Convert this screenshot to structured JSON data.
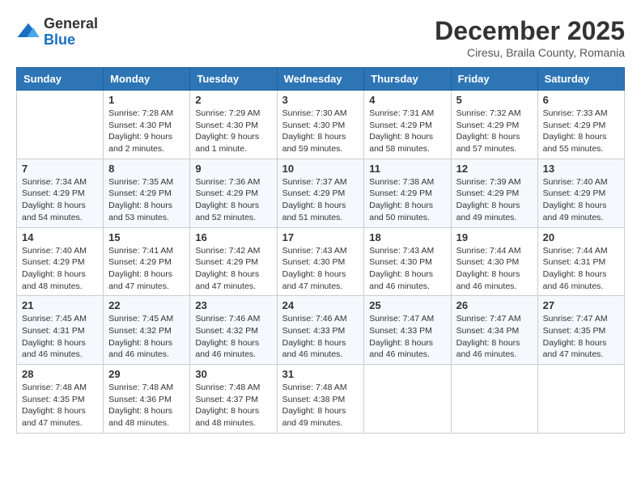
{
  "header": {
    "logo_general": "General",
    "logo_blue": "Blue",
    "month_title": "December 2025",
    "subtitle": "Ciresu, Braila County, Romania"
  },
  "days_of_week": [
    "Sunday",
    "Monday",
    "Tuesday",
    "Wednesday",
    "Thursday",
    "Friday",
    "Saturday"
  ],
  "weeks": [
    [
      {
        "day": "",
        "info": ""
      },
      {
        "day": "1",
        "info": "Sunrise: 7:28 AM\nSunset: 4:30 PM\nDaylight: 9 hours\nand 2 minutes."
      },
      {
        "day": "2",
        "info": "Sunrise: 7:29 AM\nSunset: 4:30 PM\nDaylight: 9 hours\nand 1 minute."
      },
      {
        "day": "3",
        "info": "Sunrise: 7:30 AM\nSunset: 4:30 PM\nDaylight: 8 hours\nand 59 minutes."
      },
      {
        "day": "4",
        "info": "Sunrise: 7:31 AM\nSunset: 4:29 PM\nDaylight: 8 hours\nand 58 minutes."
      },
      {
        "day": "5",
        "info": "Sunrise: 7:32 AM\nSunset: 4:29 PM\nDaylight: 8 hours\nand 57 minutes."
      },
      {
        "day": "6",
        "info": "Sunrise: 7:33 AM\nSunset: 4:29 PM\nDaylight: 8 hours\nand 55 minutes."
      }
    ],
    [
      {
        "day": "7",
        "info": "Sunrise: 7:34 AM\nSunset: 4:29 PM\nDaylight: 8 hours\nand 54 minutes."
      },
      {
        "day": "8",
        "info": "Sunrise: 7:35 AM\nSunset: 4:29 PM\nDaylight: 8 hours\nand 53 minutes."
      },
      {
        "day": "9",
        "info": "Sunrise: 7:36 AM\nSunset: 4:29 PM\nDaylight: 8 hours\nand 52 minutes."
      },
      {
        "day": "10",
        "info": "Sunrise: 7:37 AM\nSunset: 4:29 PM\nDaylight: 8 hours\nand 51 minutes."
      },
      {
        "day": "11",
        "info": "Sunrise: 7:38 AM\nSunset: 4:29 PM\nDaylight: 8 hours\nand 50 minutes."
      },
      {
        "day": "12",
        "info": "Sunrise: 7:39 AM\nSunset: 4:29 PM\nDaylight: 8 hours\nand 49 minutes."
      },
      {
        "day": "13",
        "info": "Sunrise: 7:40 AM\nSunset: 4:29 PM\nDaylight: 8 hours\nand 49 minutes."
      }
    ],
    [
      {
        "day": "14",
        "info": "Sunrise: 7:40 AM\nSunset: 4:29 PM\nDaylight: 8 hours\nand 48 minutes."
      },
      {
        "day": "15",
        "info": "Sunrise: 7:41 AM\nSunset: 4:29 PM\nDaylight: 8 hours\nand 47 minutes."
      },
      {
        "day": "16",
        "info": "Sunrise: 7:42 AM\nSunset: 4:29 PM\nDaylight: 8 hours\nand 47 minutes."
      },
      {
        "day": "17",
        "info": "Sunrise: 7:43 AM\nSunset: 4:30 PM\nDaylight: 8 hours\nand 47 minutes."
      },
      {
        "day": "18",
        "info": "Sunrise: 7:43 AM\nSunset: 4:30 PM\nDaylight: 8 hours\nand 46 minutes."
      },
      {
        "day": "19",
        "info": "Sunrise: 7:44 AM\nSunset: 4:30 PM\nDaylight: 8 hours\nand 46 minutes."
      },
      {
        "day": "20",
        "info": "Sunrise: 7:44 AM\nSunset: 4:31 PM\nDaylight: 8 hours\nand 46 minutes."
      }
    ],
    [
      {
        "day": "21",
        "info": "Sunrise: 7:45 AM\nSunset: 4:31 PM\nDaylight: 8 hours\nand 46 minutes."
      },
      {
        "day": "22",
        "info": "Sunrise: 7:45 AM\nSunset: 4:32 PM\nDaylight: 8 hours\nand 46 minutes."
      },
      {
        "day": "23",
        "info": "Sunrise: 7:46 AM\nSunset: 4:32 PM\nDaylight: 8 hours\nand 46 minutes."
      },
      {
        "day": "24",
        "info": "Sunrise: 7:46 AM\nSunset: 4:33 PM\nDaylight: 8 hours\nand 46 minutes."
      },
      {
        "day": "25",
        "info": "Sunrise: 7:47 AM\nSunset: 4:33 PM\nDaylight: 8 hours\nand 46 minutes."
      },
      {
        "day": "26",
        "info": "Sunrise: 7:47 AM\nSunset: 4:34 PM\nDaylight: 8 hours\nand 46 minutes."
      },
      {
        "day": "27",
        "info": "Sunrise: 7:47 AM\nSunset: 4:35 PM\nDaylight: 8 hours\nand 47 minutes."
      }
    ],
    [
      {
        "day": "28",
        "info": "Sunrise: 7:48 AM\nSunset: 4:35 PM\nDaylight: 8 hours\nand 47 minutes."
      },
      {
        "day": "29",
        "info": "Sunrise: 7:48 AM\nSunset: 4:36 PM\nDaylight: 8 hours\nand 48 minutes."
      },
      {
        "day": "30",
        "info": "Sunrise: 7:48 AM\nSunset: 4:37 PM\nDaylight: 8 hours\nand 48 minutes."
      },
      {
        "day": "31",
        "info": "Sunrise: 7:48 AM\nSunset: 4:38 PM\nDaylight: 8 hours\nand 49 minutes."
      },
      {
        "day": "",
        "info": ""
      },
      {
        "day": "",
        "info": ""
      },
      {
        "day": "",
        "info": ""
      }
    ]
  ]
}
